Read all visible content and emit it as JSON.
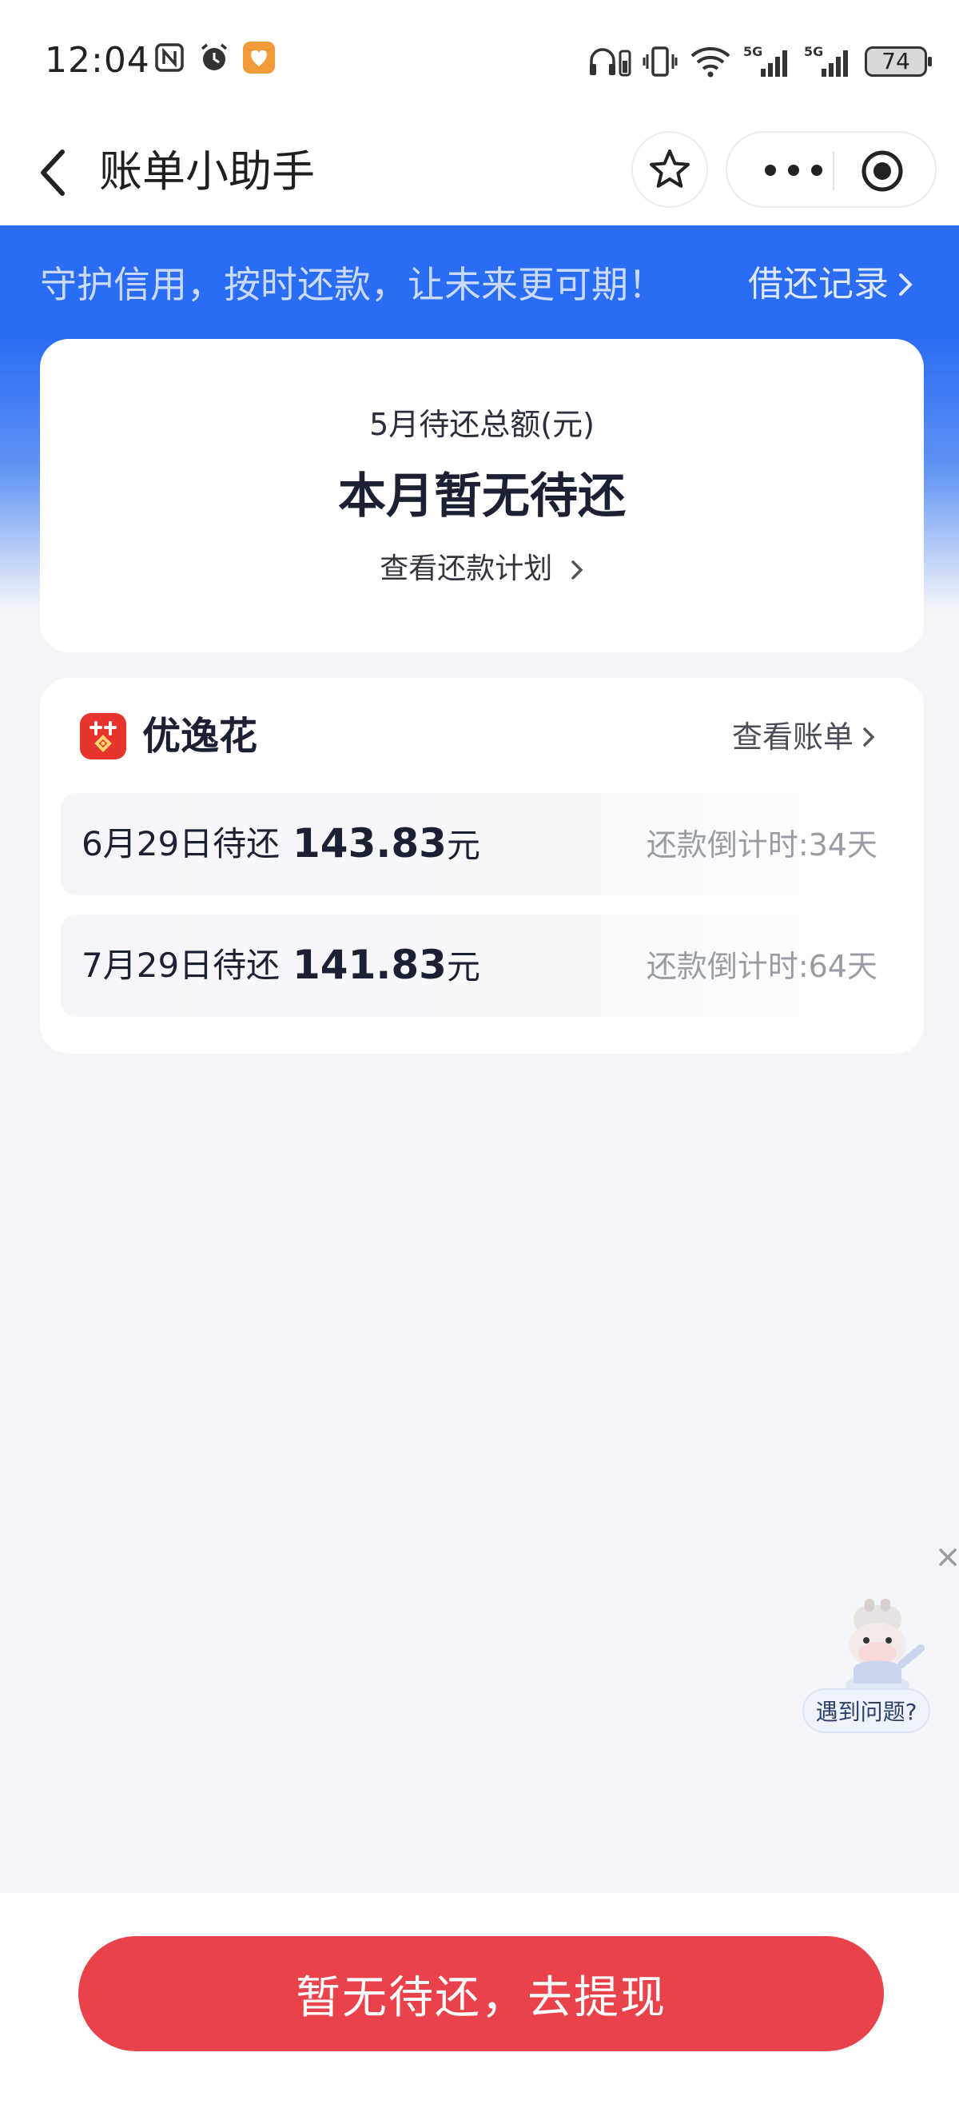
{
  "status_bar": {
    "time": "12:04",
    "battery": "74",
    "left_icons": [
      "nfc-icon",
      "alarm-icon",
      "health-app-icon"
    ],
    "right_icons": [
      "headphones-battery-icon",
      "vibrate-icon",
      "wifi-icon",
      "signal-5g-1-icon",
      "signal-5g-2-icon"
    ]
  },
  "nav": {
    "title": "账单小助手"
  },
  "banner": {
    "slogan": "守护信用，按时还款，让未来更可期！",
    "link": "借还记录"
  },
  "summary": {
    "label": "5月待还总额(元)",
    "value": "本月暂无待还",
    "link": "查看还款计划"
  },
  "loan": {
    "product_name": "优逸花",
    "bill_link": "查看账单",
    "rows": [
      {
        "date": "6月29日待还",
        "amount": "143.83",
        "unit": "元",
        "countdown": "还款倒计时:34天"
      },
      {
        "date": "7月29日待还",
        "amount": "141.83",
        "unit": "元",
        "countdown": "还款倒计时:64天"
      }
    ]
  },
  "helper": {
    "label": "遇到问题?"
  },
  "bottom": {
    "button_label": "暂无待还，去提现"
  },
  "colors": {
    "brand_blue": "#2a6cf4",
    "button_red": "#e9424a",
    "logo_red": "#e8262a"
  }
}
